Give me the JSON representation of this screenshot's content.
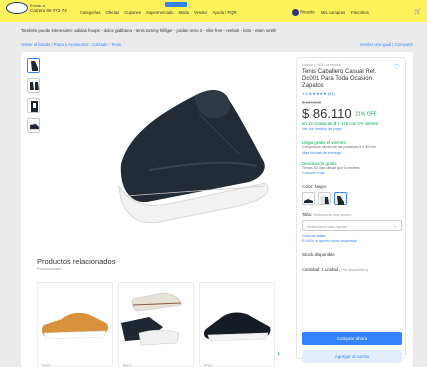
{
  "header": {
    "deliver_label": "Enviar a",
    "deliver_location": "Carrera 69 #72-74",
    "nav": [
      "Categorías",
      "Ofertas",
      "Cupones",
      "Supermercado",
      "Moda",
      "Vender",
      "Ayuda / PQR"
    ],
    "user": "Ricardo",
    "my_purchases": "Mis compras",
    "favorites": "Favoritos",
    "cart_icon": "cart-icon"
  },
  "related_searches": "También puede interesarte: adidas hoops - dolce gabbana - tenis tommy hilfiger - jordan retro 3 - nike free - reebok - lotto - etam smith",
  "breadcrumb": {
    "back": "Volver al listado",
    "items": [
      "Ropa y Accesorios",
      "Calzado",
      "Tenis"
    ],
    "right": "Vender uno igual | Compartir"
  },
  "product": {
    "condition": "Nuevo | +100 vendidos",
    "title": "Tenis Caballero Casual Ref. Dc001 Para Toda Ocasión Zapatos",
    "rating": "4.6 ★★★★★ (51)",
    "old_price": "$ 109.900",
    "price": "$ 86.110",
    "discount": "21% OFF",
    "installments": "en 12 cuotas de $ 7.176 con 0% interés",
    "payment_link": "Ver los medios de pago",
    "shipping_title": "Llega gratis el viernes",
    "shipping_text": "Comprando dentro de las próximas 8 h 35 min",
    "shipping_link": "Más formas de entrega",
    "return_title": "Devolución gratis",
    "return_text": "Tienes 30 días desde que lo recibes.",
    "return_link": "Conocer más",
    "color_label": "Color: Negro",
    "size_label": "Talla:",
    "size_hint": "Selecciona una opción",
    "size_placeholder": "Selecciona una opción",
    "size_guide": "Guía de tallas",
    "size_fit": "El 84% si quedó como esperaba",
    "stock": "Stock disponible",
    "qty_label": "Cantidad: 1 unidad",
    "qty_avail": "(+50 disponibles)",
    "buy_button": "Comprar ahora",
    "cart_button": "Agregar al carrito"
  },
  "related": {
    "title": "Productos relacionados",
    "subtitle": "Promocionado",
    "cards": [
      {
        "caption": "Nuevo"
      },
      {
        "caption": "Nuevo"
      },
      {
        "caption": "Nuevo"
      }
    ]
  },
  "colors": {
    "accent": "#3483fa",
    "header": "#fff159",
    "green": "#00a650"
  }
}
